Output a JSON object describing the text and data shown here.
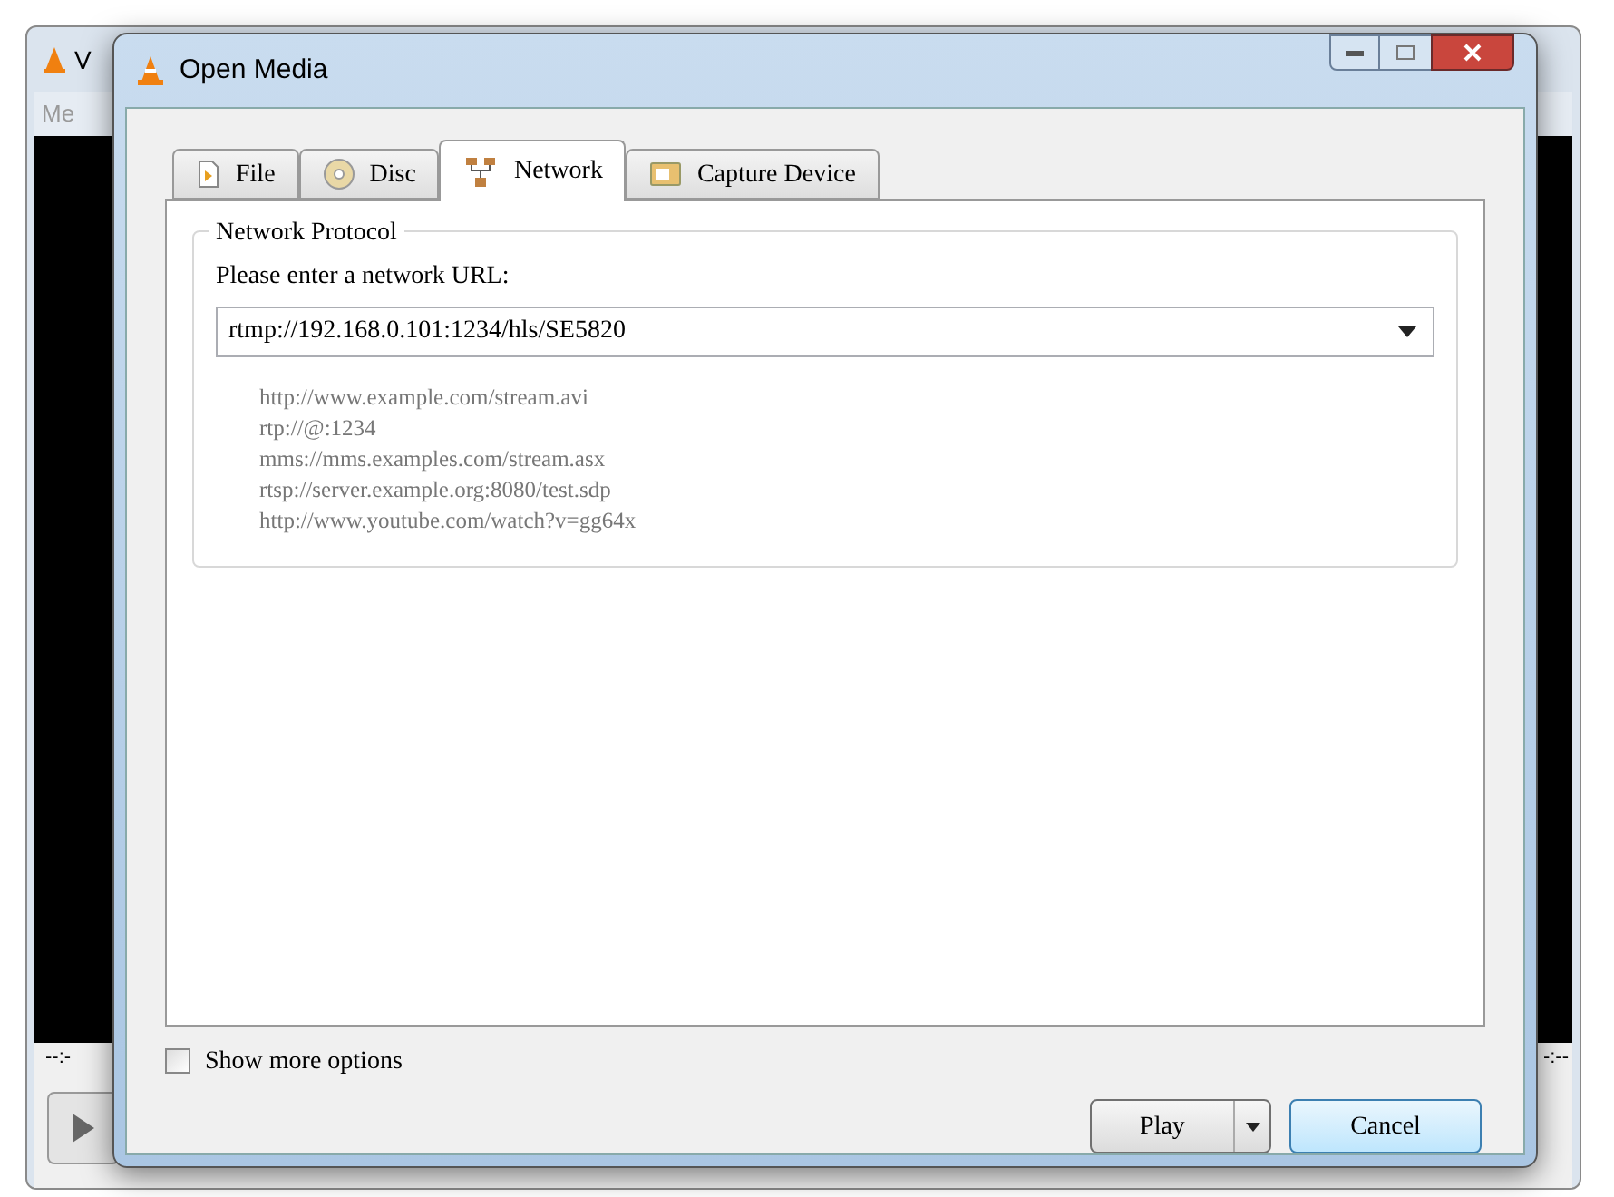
{
  "background_window": {
    "title": "V",
    "menu": "Me",
    "time_elapsed": "--:-",
    "time_total": "-:--"
  },
  "window": {
    "title": "Open Media"
  },
  "tabs": [
    {
      "label": "File",
      "kind": "file",
      "selected": false
    },
    {
      "label": "Disc",
      "kind": "disc",
      "selected": false
    },
    {
      "label": "Network",
      "kind": "network",
      "selected": true
    },
    {
      "label": "Capture Device",
      "kind": "capture",
      "selected": false
    }
  ],
  "group": {
    "title": "Network Protocol",
    "prompt": "Please enter a network URL:",
    "url": {
      "value": "rtmp://192.168.0.101:1234/hls/SE5820"
    },
    "examples": [
      "http://www.example.com/stream.avi",
      "rtp://@:1234",
      "mms://mms.examples.com/stream.asx",
      "rtsp://server.example.org:8080/test.sdp",
      "http://www.youtube.com/watch?v=gg64x"
    ]
  },
  "show_more_options": {
    "label": "Show more options",
    "checked": false
  },
  "buttons": [
    {
      "label": "Play",
      "kind": "split"
    },
    {
      "label": "Cancel",
      "kind": "plain"
    }
  ]
}
